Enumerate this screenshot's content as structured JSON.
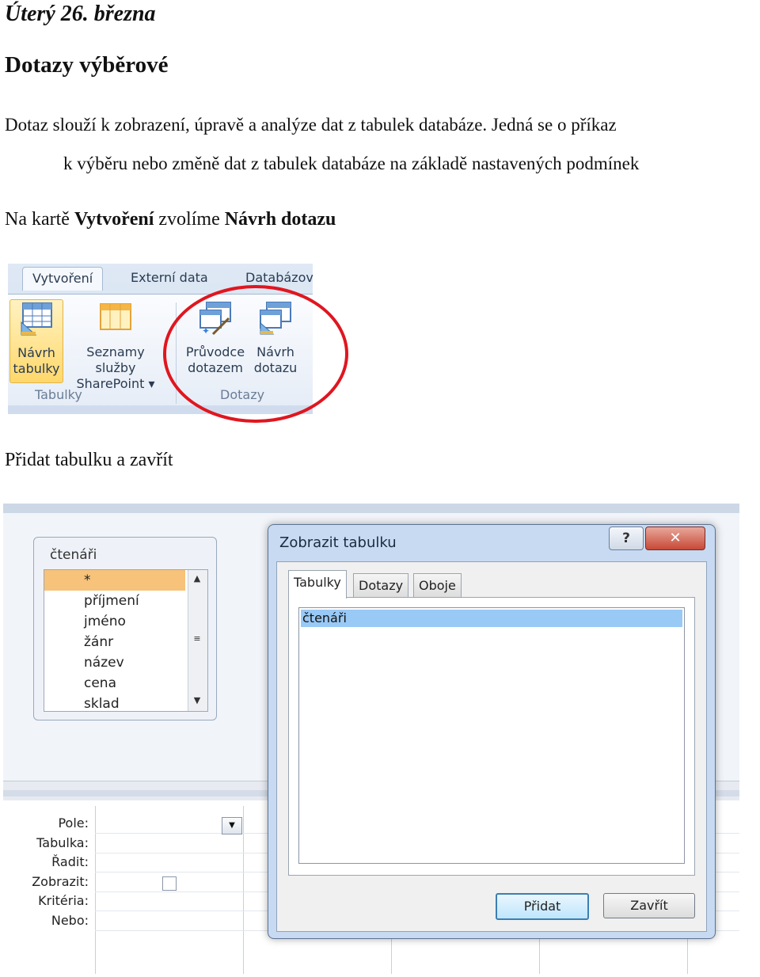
{
  "doc": {
    "date": "Úterý 26. března",
    "heading": "Dotazy výběrové",
    "para1_line1": "Dotaz slouží k zobrazení, úpravě a analýze dat z tabulek databáze. Jedná se o příkaz",
    "para1_line2": "k výběru nebo změně dat z tabulek databáze na základě nastavených podmínek",
    "instr_prefix": "Na kartě ",
    "instr_bold1": "Vytvoření",
    "instr_mid": " zvolíme ",
    "instr_bold2": "Návrh dotazu",
    "instr2": "Přidat tabulku a zavřít"
  },
  "ribbon": {
    "tabs": [
      "Vytvoření",
      "Externí data",
      "Databázov"
    ],
    "buttons": {
      "navrh_tabulky": [
        "Návrh",
        "tabulky"
      ],
      "seznamy": [
        "Seznamy služby",
        "SharePoint ▾"
      ],
      "pruvodce": [
        "Průvodce",
        "dotazem"
      ],
      "navrh_dotazu": [
        "Návrh",
        "dotazu"
      ]
    },
    "groups": [
      "Tabulky",
      "Dotazy"
    ],
    "highlight_color": "#e0161f"
  },
  "table_box": {
    "title": "čtenáři",
    "fields": [
      "*",
      "příjmení",
      "jméno",
      "žánr",
      "název",
      "cena",
      "sklad"
    ]
  },
  "grid": {
    "row_labels": [
      "Pole:",
      "Tabulka:",
      "Řadit:",
      "Zobrazit:",
      "Kritéria:",
      "Nebo:"
    ]
  },
  "dialog": {
    "title": "Zobrazit tabulku",
    "help_label": "?",
    "close_label": "✕",
    "tabs": [
      "Tabulky",
      "Dotazy",
      "Oboje"
    ],
    "list_items": [
      "čtenáři"
    ],
    "add_button": "Přidat",
    "close_button": "Zavřít"
  }
}
